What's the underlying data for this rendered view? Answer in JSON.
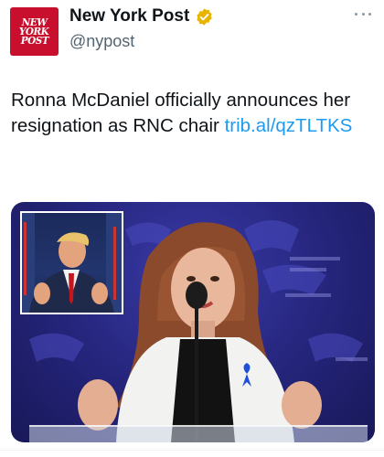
{
  "account": {
    "display_name": "New York Post",
    "handle": "@nypost",
    "avatar_text": [
      "NEW",
      "YORK",
      "POST"
    ],
    "verified_badge_color": "#e8b400"
  },
  "tweet": {
    "text": "Ronna McDaniel officially announces her resignation as RNC chair ",
    "link_text": "trib.al/qzTLTKS",
    "link_color": "#1d9bf0"
  },
  "media": {
    "main_image": "woman-speaking-at-podium-photo",
    "inset_image": "man-applauding-portrait-photo"
  },
  "colors": {
    "brand_red": "#c8102e",
    "backdrop_blue": "#2a2a8c"
  }
}
